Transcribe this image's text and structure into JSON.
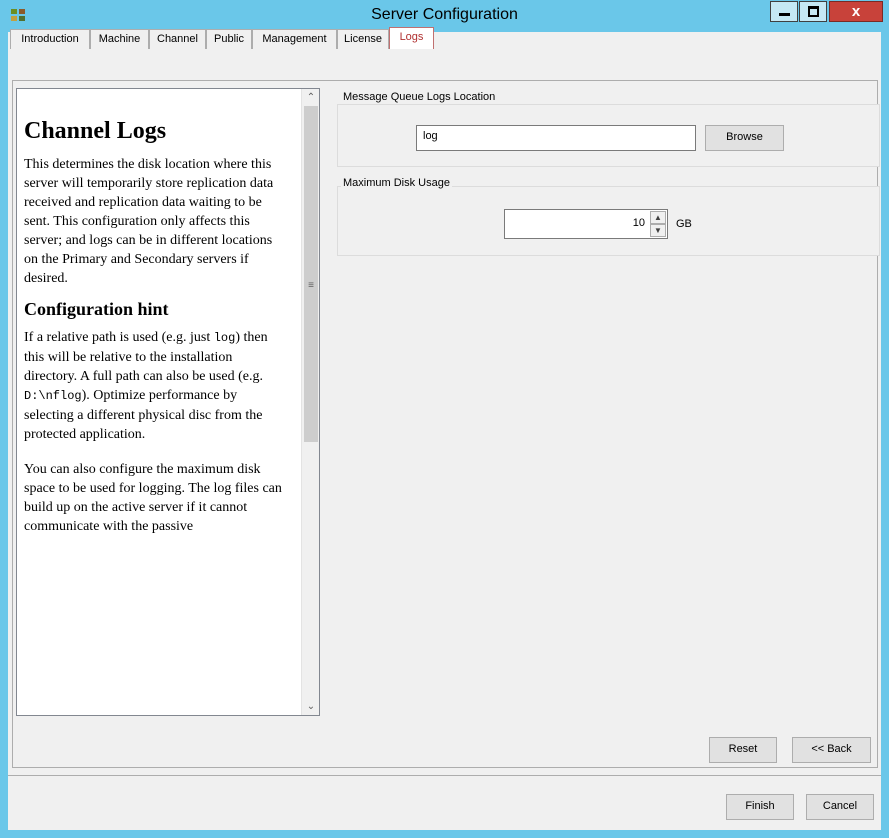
{
  "window": {
    "title": "Server Configuration",
    "icon": "app-icon",
    "controls": {
      "minimize": "minimize-icon",
      "maximize": "maximize-icon",
      "close": "x"
    }
  },
  "tabs": [
    {
      "label": "Introduction",
      "active": false
    },
    {
      "label": "Machine",
      "active": false
    },
    {
      "label": "Channel",
      "active": false
    },
    {
      "label": "Public",
      "active": false
    },
    {
      "label": "Management",
      "active": false
    },
    {
      "label": "License",
      "active": false
    },
    {
      "label": "Logs",
      "active": true
    }
  ],
  "help": {
    "heading": "Channel Logs",
    "para1": "This determines the disk location where this server will temporarily store replication data received and replication data waiting to be sent. This configuration only affects this server; and logs can be in different locations on the Primary and Secondary servers if desired.",
    "hint_heading": "Configuration hint",
    "hint_a": "If a relative path is used (e.g. just ",
    "hint_code1": "log",
    "hint_b": ") then this will be relative to the installation directory. A full path can also be used (e.g. ",
    "hint_code2": "D:\\nflog",
    "hint_c": "). Optimize performance by selecting a different physical disc from the protected application.",
    "para3": "You can also configure the maximum disk space to be used for logging. The log files can build up on the active server if it cannot communicate with the passive"
  },
  "logs_location": {
    "group_label": "Message Queue Logs Location",
    "value": "log",
    "browse_label": "Browse"
  },
  "disk_usage": {
    "group_label": "Maximum Disk Usage",
    "value": "10",
    "unit": "GB"
  },
  "buttons": {
    "reset": "Reset",
    "back": "<< Back",
    "finish": "Finish",
    "cancel": "Cancel"
  },
  "colors": {
    "titlebar": "#6ac7e9",
    "close_button": "#c8423a",
    "active_tab_text": "#b03030"
  }
}
